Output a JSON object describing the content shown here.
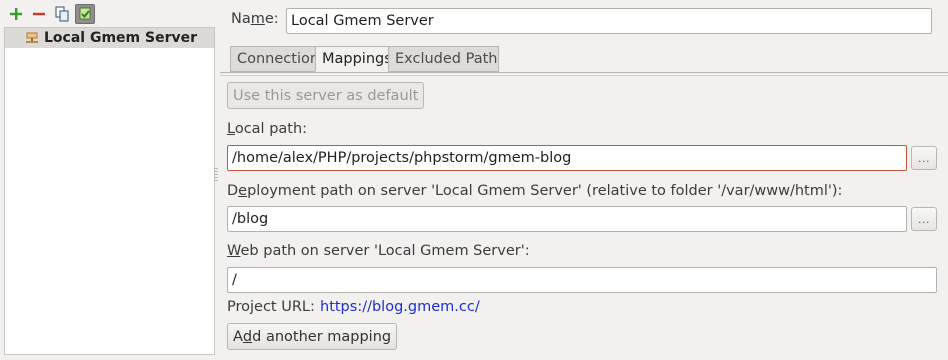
{
  "toolbar": {
    "icons": [
      "add-icon",
      "remove-icon",
      "copy-icon",
      "use-as-default-icon"
    ]
  },
  "servers": [
    {
      "label": "Local Gmem Server",
      "selected": true
    }
  ],
  "form": {
    "name_label_pre": "Na",
    "name_label_u": "m",
    "name_label_post": "e:",
    "name_value": "Local Gmem Server",
    "tabs": [
      {
        "label": "Connection",
        "selected": false
      },
      {
        "label": "Mappings",
        "selected": true
      },
      {
        "label": "Excluded Paths",
        "selected": false
      }
    ],
    "use_default_label": "Use this server as default",
    "local_path_label_pre": "",
    "local_path_label_u": "L",
    "local_path_label_post": "ocal path:",
    "local_path_value": "/home/alex/PHP/projects/phpstorm/gmem-blog",
    "deploy_label_pre": "D",
    "deploy_label_u": "e",
    "deploy_label_post": "ployment path on server 'Local Gmem Server' (relative to folder '/var/www/html'):",
    "deploy_value": "/blog",
    "web_label_pre": "",
    "web_label_u": "W",
    "web_label_post": "eb path on server 'Local Gmem Server':",
    "web_value": "/",
    "project_url_label": "Project URL:",
    "project_url_value": "https://blog.gmem.cc/",
    "add_mapping_pre": "A",
    "add_mapping_u": "d",
    "add_mapping_post": "d another mapping",
    "browse_label": "..."
  },
  "colors": {
    "add_icon": "#3a9a2e",
    "remove_icon": "#d2332d",
    "focus_border": "#c7553b",
    "link": "#1a2fd1"
  }
}
